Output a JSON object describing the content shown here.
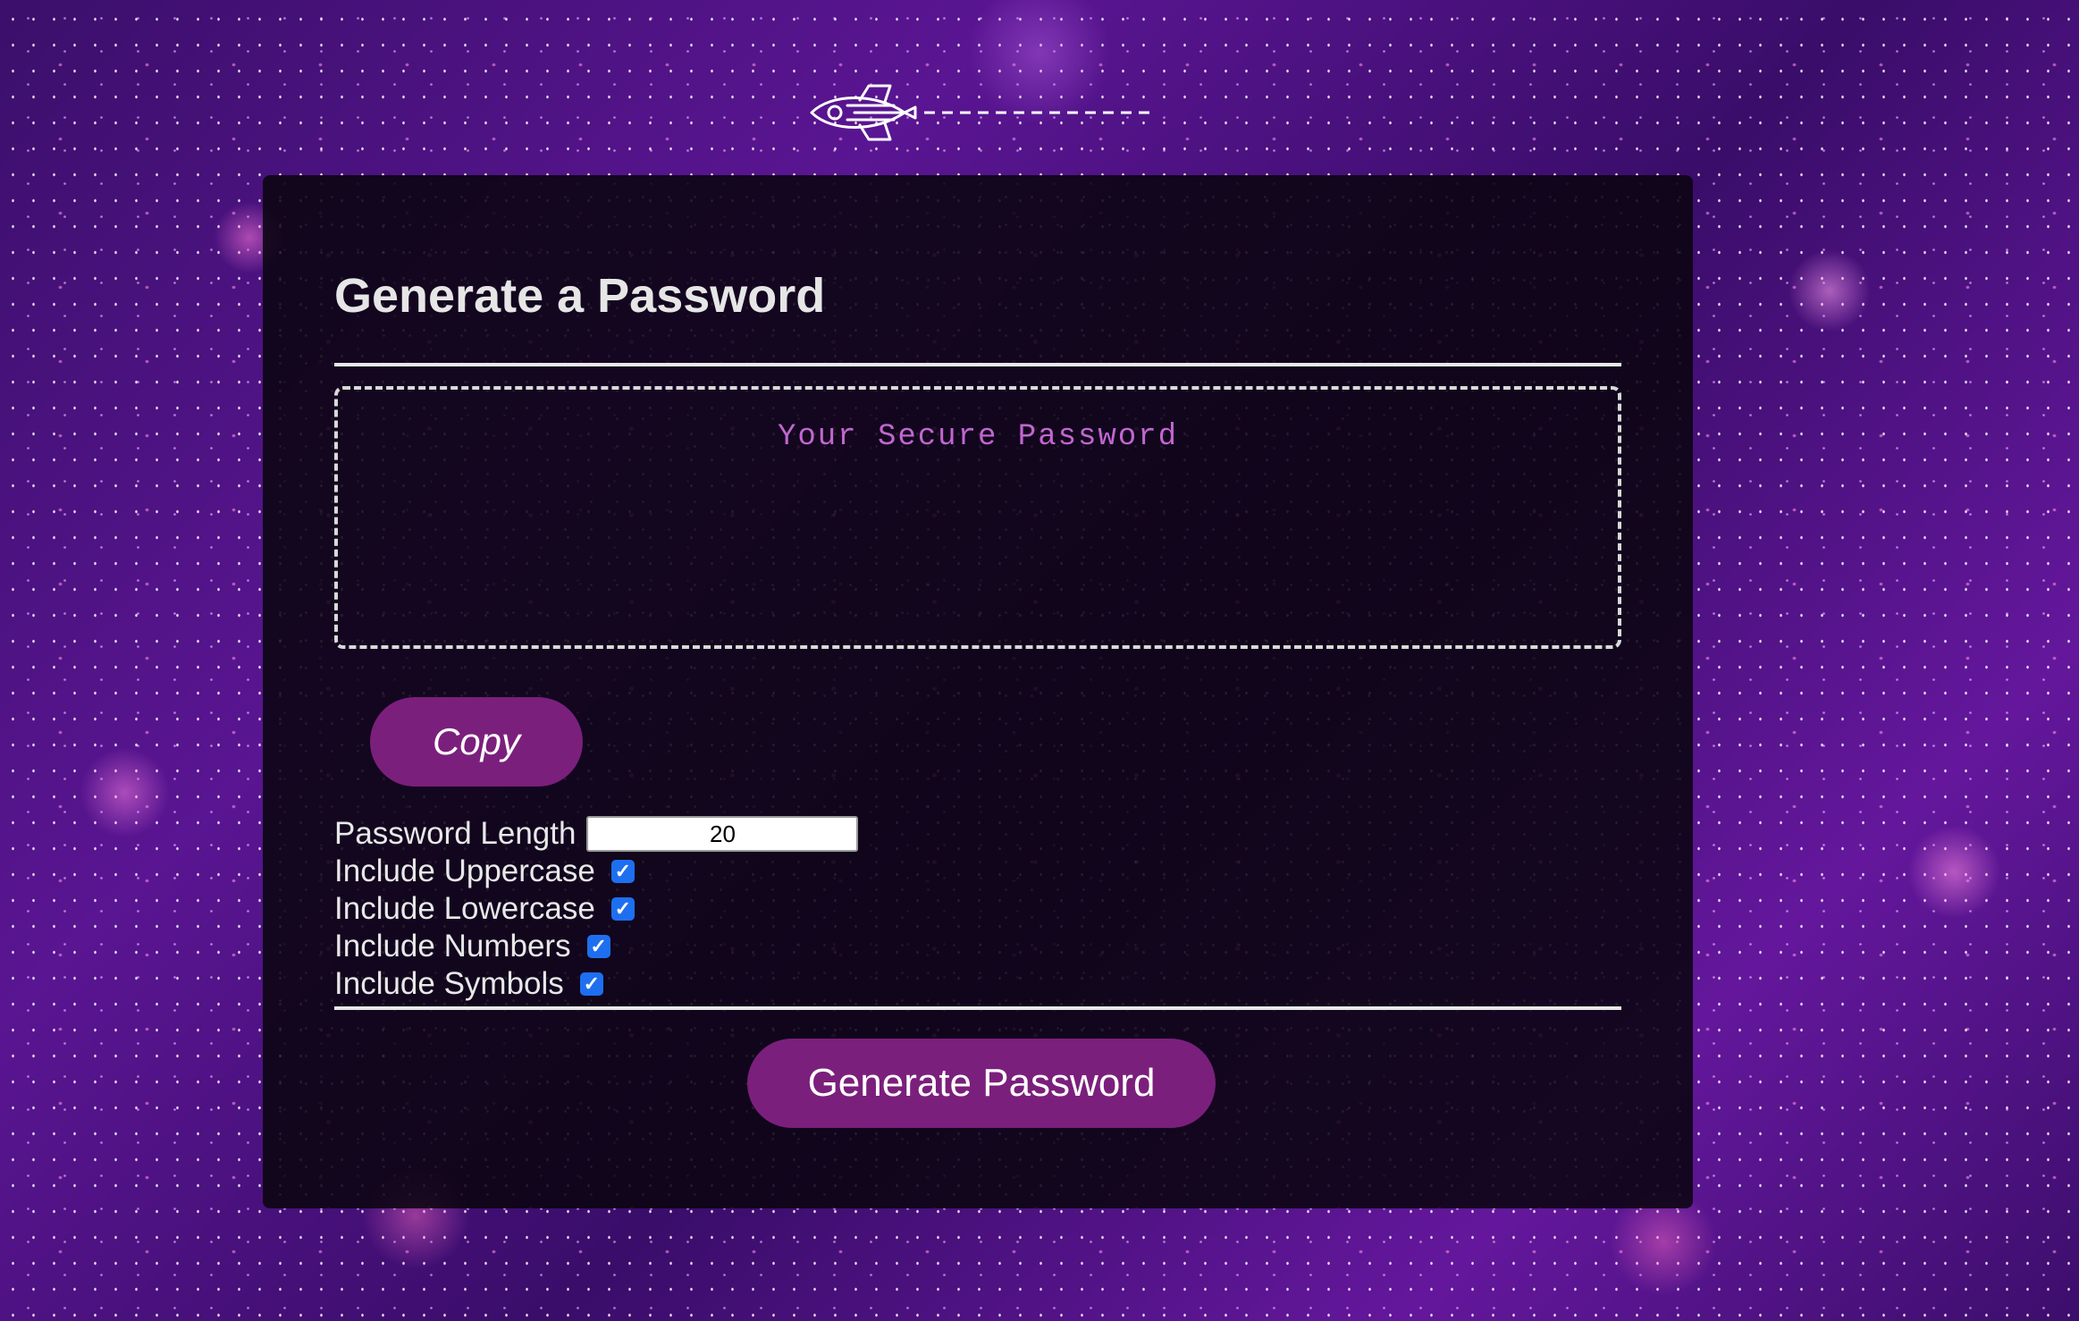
{
  "header": {
    "logo_icon": "rocket-icon"
  },
  "card": {
    "title": "Generate a Password",
    "password_placeholder": "Your Secure Password",
    "password_value": "",
    "copy_label": "Copy",
    "generate_label": "Generate Password"
  },
  "options": {
    "length_label": "Password Length",
    "length_value": "20",
    "uppercase_label": "Include Uppercase",
    "uppercase_checked": true,
    "lowercase_label": "Include Lowercase",
    "lowercase_checked": true,
    "numbers_label": "Include Numbers",
    "numbers_checked": true,
    "symbols_label": "Include Symbols",
    "symbols_checked": true
  },
  "colors": {
    "button": "#7b1f7c",
    "checkbox": "#1e6ff0",
    "card_bg": "#0a0410"
  }
}
